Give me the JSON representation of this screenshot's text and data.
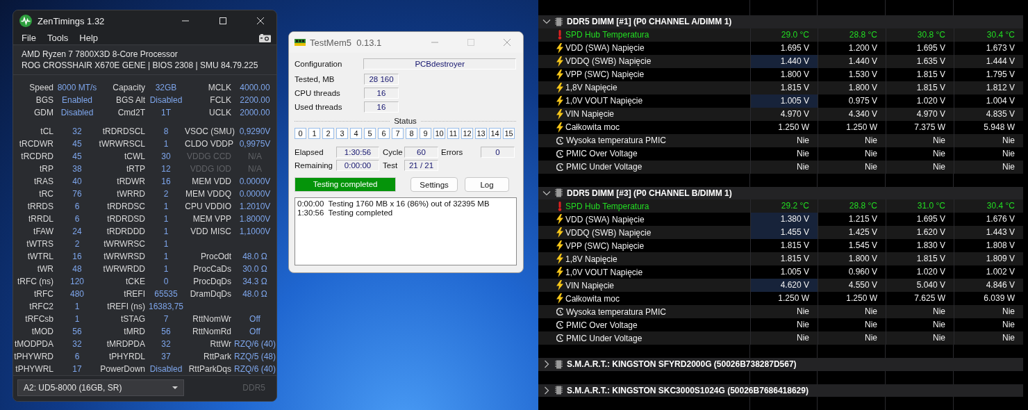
{
  "zentimings": {
    "title": "ZenTimings 1.32",
    "menu": [
      "File",
      "Tools",
      "Help"
    ],
    "cpu": "AMD Ryzen 7 7800X3D 8-Core Processor",
    "board": "ROG CROSSHAIR X670E GENE | BIOS 2308 | SMU 84.79.225",
    "summary": [
      [
        {
          "label": "Speed",
          "value": "8000 MT/s",
          "disabled": false
        },
        {
          "label": "Capacity",
          "value": "32GB",
          "disabled": false
        },
        {
          "label": "MCLK",
          "value": "4000.00",
          "disabled": false
        }
      ],
      [
        {
          "label": "BGS",
          "value": "Enabled",
          "disabled": false
        },
        {
          "label": "BGS Alt",
          "value": "Disabled",
          "disabled": false
        },
        {
          "label": "FCLK",
          "value": "2200.00",
          "disabled": false
        }
      ],
      [
        {
          "label": "GDM",
          "value": "Disabled",
          "disabled": false
        },
        {
          "label": "Cmd2T",
          "value": "1T",
          "disabled": false
        },
        {
          "label": "UCLK",
          "value": "2000.00",
          "disabled": false
        }
      ]
    ],
    "timings": [
      [
        {
          "label": "tCL",
          "value": "32",
          "disabled": false
        },
        {
          "label": "tRDRDSCL",
          "value": "8",
          "disabled": false
        },
        {
          "label": "VSOC (SMU)",
          "value": "0,9290V",
          "disabled": false
        }
      ],
      [
        {
          "label": "tRCDWR",
          "value": "45",
          "disabled": false
        },
        {
          "label": "tWRWRSCL",
          "value": "1",
          "disabled": false
        },
        {
          "label": "CLDO VDDP",
          "value": "0,9975V",
          "disabled": false
        }
      ],
      [
        {
          "label": "tRCDRD",
          "value": "45",
          "disabled": false
        },
        {
          "label": "tCWL",
          "value": "30",
          "disabled": false
        },
        {
          "label": "VDDG CCD",
          "value": "N/A",
          "disabled": true
        }
      ],
      [
        {
          "label": "tRP",
          "value": "38",
          "disabled": false
        },
        {
          "label": "tRTP",
          "value": "12",
          "disabled": false
        },
        {
          "label": "VDDG IOD",
          "value": "N/A",
          "disabled": true
        }
      ],
      [
        {
          "label": "tRAS",
          "value": "40",
          "disabled": false
        },
        {
          "label": "tRDWR",
          "value": "16",
          "disabled": false
        },
        {
          "label": "MEM VDD",
          "value": "0.0000V",
          "disabled": false
        }
      ],
      [
        {
          "label": "tRC",
          "value": "76",
          "disabled": false
        },
        {
          "label": "tWRRD",
          "value": "2",
          "disabled": false
        },
        {
          "label": "MEM VDDQ",
          "value": "0.0000V",
          "disabled": false
        }
      ],
      [
        {
          "label": "tRRDS",
          "value": "6",
          "disabled": false
        },
        {
          "label": "tRDRDSC",
          "value": "1",
          "disabled": false
        },
        {
          "label": "CPU VDDIO",
          "value": "1.2010V",
          "disabled": false
        }
      ],
      [
        {
          "label": "tRRDL",
          "value": "6",
          "disabled": false
        },
        {
          "label": "tRDRDSD",
          "value": "1",
          "disabled": false
        },
        {
          "label": "MEM VPP",
          "value": "1.8000V",
          "disabled": false
        }
      ],
      [
        {
          "label": "tFAW",
          "value": "24",
          "disabled": false
        },
        {
          "label": "tRDRDDD",
          "value": "1",
          "disabled": false
        },
        {
          "label": "VDD MISC",
          "value": "1,1000V",
          "disabled": false
        }
      ],
      [
        {
          "label": "tWTRS",
          "value": "2",
          "disabled": false
        },
        {
          "label": "tWRWRSC",
          "value": "1",
          "disabled": false
        }
      ],
      [
        {
          "label": "tWTRL",
          "value": "16",
          "disabled": false
        },
        {
          "label": "tWRWRSD",
          "value": "1",
          "disabled": false
        },
        {
          "label": "ProcOdt",
          "value": "48.0 Ω",
          "disabled": false
        }
      ],
      [
        {
          "label": "tWR",
          "value": "48",
          "disabled": false
        },
        {
          "label": "tWRWRDD",
          "value": "1",
          "disabled": false
        },
        {
          "label": "ProcCaDs",
          "value": "30.0 Ω",
          "disabled": false
        }
      ],
      [
        {
          "label": "tRFC (ns)",
          "value": "120",
          "disabled": false
        },
        {
          "label": "tCKE",
          "value": "0",
          "disabled": false
        },
        {
          "label": "ProcDqDs",
          "value": "34.3 Ω",
          "disabled": false
        }
      ],
      [
        {
          "label": "tRFC",
          "value": "480",
          "disabled": false
        },
        {
          "label": "tREFI",
          "value": "65535",
          "disabled": false
        },
        {
          "label": "DramDqDs",
          "value": "48.0 Ω",
          "disabled": false
        }
      ],
      [
        {
          "label": "tRFC2",
          "value": "1",
          "disabled": false
        },
        {
          "label": "tREFI (ns)",
          "value": "16383,75",
          "disabled": false
        }
      ],
      [
        {
          "label": "tRFCsb",
          "value": "1",
          "disabled": false
        },
        {
          "label": "tSTAG",
          "value": "7",
          "disabled": false
        },
        {
          "label": "RttNomWr",
          "value": "Off",
          "disabled": false
        }
      ],
      [
        {
          "label": "tMOD",
          "value": "56",
          "disabled": false
        },
        {
          "label": "tMRD",
          "value": "56",
          "disabled": false
        },
        {
          "label": "RttNomRd",
          "value": "Off",
          "disabled": false
        }
      ],
      [
        {
          "label": "tMODPDA",
          "value": "32",
          "disabled": false
        },
        {
          "label": "tMRDPDA",
          "value": "32",
          "disabled": false
        },
        {
          "label": "RttWr",
          "value": "RZQ/6 (40)",
          "disabled": false
        }
      ],
      [
        {
          "label": "tPHYWRD",
          "value": "6",
          "disabled": false
        },
        {
          "label": "tPHYRDL",
          "value": "37",
          "disabled": false
        },
        {
          "label": "RttPark",
          "value": "RZQ/5 (48)",
          "disabled": false
        }
      ],
      [
        {
          "label": "tPHYWRL",
          "value": "17",
          "disabled": false
        },
        {
          "label": "PowerDown",
          "value": "Disabled",
          "disabled": false
        },
        {
          "label": "RttParkDqs",
          "value": "RZQ/6 (40)",
          "disabled": false
        }
      ]
    ],
    "module": "A2: UD5-8000 (16GB, SR)",
    "memory_type": "DDR5"
  },
  "testmem": {
    "title": "TestMem5  0.13.1",
    "fields": [
      {
        "label": "Configuration",
        "value": "PCBdestroyer"
      },
      {
        "label": "Tested, MB",
        "value": "28 160"
      },
      {
        "label": "CPU threads",
        "value": "16"
      },
      {
        "label": "Used threads",
        "value": "16"
      }
    ],
    "status_label": "Status",
    "threads": [
      "0",
      "1",
      "2",
      "3",
      "4",
      "5",
      "6",
      "7",
      "8",
      "9",
      "10",
      "11",
      "12",
      "13",
      "14",
      "15"
    ],
    "stats": [
      {
        "label": "Elapsed",
        "value": "1:30:56"
      },
      {
        "label": "Cycle",
        "value": "60"
      },
      {
        "label": "Errors",
        "value": "0"
      },
      {
        "label": "Remaining",
        "value": "0:00:00"
      },
      {
        "label": "Test",
        "value": "21 / 21"
      }
    ],
    "progress": {
      "text": "Testing completed",
      "level": 1
    },
    "buttons": [
      "Settings",
      "Log"
    ],
    "log": [
      "0:00:00  Testing 1760 MB x 16 (86%) out of 32395 MB",
      "1:30:56  Testing completed"
    ]
  },
  "sensors": {
    "sections": [
      {
        "title": "DDR5 DIMM [#1] (P0 CHANNEL A/DIMM 1)",
        "expanded": true,
        "rows": [
          {
            "kind": "temperature",
            "label": "SPD Hub Temperatura",
            "values": [
              "29.0 °C",
              "28.8 °C",
              "30.8 °C",
              "30.4 °C"
            ],
            "highlighted": false
          },
          {
            "kind": "voltage",
            "label": "VDD (SWA) Napięcie",
            "values": [
              "1.695 V",
              "1.200 V",
              "1.695 V",
              "1.673 V"
            ],
            "highlighted": false
          },
          {
            "kind": "voltage",
            "label": "VDDQ (SWB) Napięcie",
            "values": [
              "1.440 V",
              "1.440 V",
              "1.635 V",
              "1.444 V"
            ],
            "highlighted": true
          },
          {
            "kind": "voltage",
            "label": "VPP (SWC) Napięcie",
            "values": [
              "1.800 V",
              "1.530 V",
              "1.815 V",
              "1.795 V"
            ],
            "highlighted": false
          },
          {
            "kind": "voltage",
            "label": "1,8V Napięcie",
            "values": [
              "1.815 V",
              "1.800 V",
              "1.815 V",
              "1.812 V"
            ],
            "highlighted": false
          },
          {
            "kind": "voltage",
            "label": "1,0V VOUT Napięcie",
            "values": [
              "1.005 V",
              "0.975 V",
              "1.020 V",
              "1.004 V"
            ],
            "highlighted": true
          },
          {
            "kind": "voltage",
            "label": "VIN Napięcie",
            "values": [
              "4.970 V",
              "4.340 V",
              "4.970 V",
              "4.835 V"
            ],
            "highlighted": false
          },
          {
            "kind": "voltage",
            "label": "Całkowita moc",
            "values": [
              "1.250 W",
              "1.250 W",
              "7.375 W",
              "5.948 W"
            ],
            "highlighted": false
          },
          {
            "kind": "alarm",
            "label": "Wysoka temperatura PMIC",
            "values": [
              "Nie",
              "Nie",
              "Nie",
              "Nie"
            ],
            "highlighted": false
          },
          {
            "kind": "alarm",
            "label": "PMIC Over Voltage",
            "values": [
              "Nie",
              "Nie",
              "Nie",
              "Nie"
            ],
            "highlighted": false
          },
          {
            "kind": "alarm",
            "label": "PMIC Under Voltage",
            "values": [
              "Nie",
              "Nie",
              "Nie",
              "Nie"
            ],
            "highlighted": false
          }
        ]
      },
      {
        "title": "DDR5 DIMM [#3] (P0 CHANNEL B/DIMM 1)",
        "expanded": true,
        "rows": [
          {
            "kind": "temperature",
            "label": "SPD Hub Temperatura",
            "values": [
              "29.2 °C",
              "28.8 °C",
              "31.0 °C",
              "30.4 °C"
            ],
            "highlighted": false
          },
          {
            "kind": "voltage",
            "label": "VDD (SWA) Napięcie",
            "values": [
              "1.380 V",
              "1.215 V",
              "1.695 V",
              "1.676 V"
            ],
            "highlighted": true
          },
          {
            "kind": "voltage",
            "label": "VDDQ (SWB) Napięcie",
            "values": [
              "1.455 V",
              "1.425 V",
              "1.620 V",
              "1.443 V"
            ],
            "highlighted": true
          },
          {
            "kind": "voltage",
            "label": "VPP (SWC) Napięcie",
            "values": [
              "1.815 V",
              "1.545 V",
              "1.830 V",
              "1.808 V"
            ],
            "highlighted": false
          },
          {
            "kind": "voltage",
            "label": "1,8V Napięcie",
            "values": [
              "1.815 V",
              "1.800 V",
              "1.815 V",
              "1.809 V"
            ],
            "highlighted": false
          },
          {
            "kind": "voltage",
            "label": "1,0V VOUT Napięcie",
            "values": [
              "1.005 V",
              "0.960 V",
              "1.020 V",
              "1.002 V"
            ],
            "highlighted": false
          },
          {
            "kind": "voltage",
            "label": "VIN Napięcie",
            "values": [
              "4.620 V",
              "4.550 V",
              "5.040 V",
              "4.846 V"
            ],
            "highlighted": true
          },
          {
            "kind": "voltage",
            "label": "Całkowita moc",
            "values": [
              "1.250 W",
              "1.250 W",
              "7.625 W",
              "6.039 W"
            ],
            "highlighted": false
          },
          {
            "kind": "alarm",
            "label": "Wysoka temperatura PMIC",
            "values": [
              "Nie",
              "Nie",
              "Nie",
              "Nie"
            ],
            "highlighted": false
          },
          {
            "kind": "alarm",
            "label": "PMIC Over Voltage",
            "values": [
              "Nie",
              "Nie",
              "Nie",
              "Nie"
            ],
            "highlighted": false
          },
          {
            "kind": "alarm",
            "label": "PMIC Under Voltage",
            "values": [
              "Nie",
              "Nie",
              "Nie",
              "Nie"
            ],
            "highlighted": false
          }
        ]
      },
      {
        "title": "S.M.A.R.T.: KINGSTON SFYRD2000G (50026B738287D567)",
        "expanded": false
      },
      {
        "title": "S.M.A.R.T.: KINGSTON SKC3000S1024G (50026B7686418629)",
        "expanded": false
      }
    ]
  }
}
